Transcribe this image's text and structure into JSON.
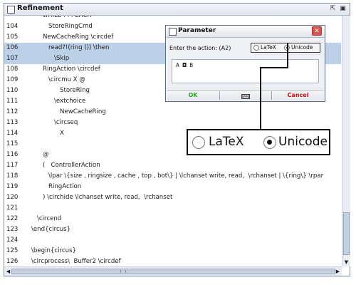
{
  "window": {
    "title": "Refinement"
  },
  "editor": {
    "lines": [
      {
        "num": "",
        "code": "wHILE . . . EACH",
        "indent": 3,
        "highlighted": false
      },
      {
        "num": "104",
        "code": "StoreRingCmd",
        "indent": 4,
        "highlighted": false
      },
      {
        "num": "105",
        "code": "NewCacheRing \\circdef",
        "indent": 3,
        "highlighted": false
      },
      {
        "num": "106",
        "code": "read?!(ring ()) \\then",
        "indent": 4,
        "highlighted": true
      },
      {
        "num": "107",
        "code": "\\Skip",
        "indent": 5,
        "highlighted": true
      },
      {
        "num": "108",
        "code": "RingAction \\circdef",
        "indent": 3,
        "highlighted": false
      },
      {
        "num": "109",
        "code": "\\circmu X @",
        "indent": 4,
        "highlighted": false
      },
      {
        "num": "110",
        "code": "StoreRing",
        "indent": 6,
        "highlighted": false
      },
      {
        "num": "111",
        "code": "\\extchoice",
        "indent": 5,
        "highlighted": false
      },
      {
        "num": "112",
        "code": "NewCacheRing",
        "indent": 6,
        "highlighted": false
      },
      {
        "num": "113",
        "code": "\\circseq",
        "indent": 5,
        "highlighted": false
      },
      {
        "num": "114",
        "code": "X",
        "indent": 6,
        "highlighted": false
      },
      {
        "num": "115",
        "code": "",
        "indent": 0,
        "highlighted": false
      },
      {
        "num": "116",
        "code": "@",
        "indent": 3,
        "highlighted": false
      },
      {
        "num": "117",
        "code": "(   ControllerAction",
        "indent": 3,
        "highlighted": false
      },
      {
        "num": "118",
        "code": "\\lpar \\{size , ringsize , cache , top , bot\\} | \\lchanset write, read,  \\rchanset | \\{ring\\} \\rpar",
        "indent": 4,
        "highlighted": false
      },
      {
        "num": "119",
        "code": "RingAction",
        "indent": 4,
        "highlighted": false
      },
      {
        "num": "120",
        "code": ") \\circhide \\lchanset write, read,  \\rchanset",
        "indent": 3,
        "highlighted": false
      },
      {
        "num": "121",
        "code": "",
        "indent": 0,
        "highlighted": false
      },
      {
        "num": "122",
        "code": "\\circend",
        "indent": 2,
        "highlighted": false
      },
      {
        "num": "123",
        "code": "\\end{circus}",
        "indent": 1,
        "highlighted": false
      },
      {
        "num": "124",
        "code": "",
        "indent": 0,
        "highlighted": false
      },
      {
        "num": "125",
        "code": "\\begin{circus}",
        "indent": 1,
        "highlighted": false
      },
      {
        "num": "126",
        "code": "\\circprocess\\  Buffer2 \\circdef",
        "indent": 1,
        "highlighted": false
      }
    ]
  },
  "dialog": {
    "title": "Parameter",
    "prompt": "Enter the action: (A2)",
    "radio_latex": "LaTeX",
    "radio_unicode": "Unicode",
    "selected": "Unicode",
    "input_value": "A ◘ B",
    "ok_label": "OK",
    "cancel_label": "Cancel"
  },
  "zoom": {
    "radio_latex": "LaTeX",
    "radio_unicode": "Unicode",
    "selected": "Unicode"
  },
  "colors": {
    "highlight": "#bcd0e8",
    "ok": "#2aa52a",
    "cancel": "#cc1111",
    "close": "#d9534f"
  },
  "icons": [
    "window-icon",
    "restore-icon",
    "maximize-icon",
    "close-icon",
    "keyboard-icon",
    "scroll-arrow-left-icon",
    "scroll-arrow-right-icon",
    "scroll-arrow-down-icon"
  ]
}
